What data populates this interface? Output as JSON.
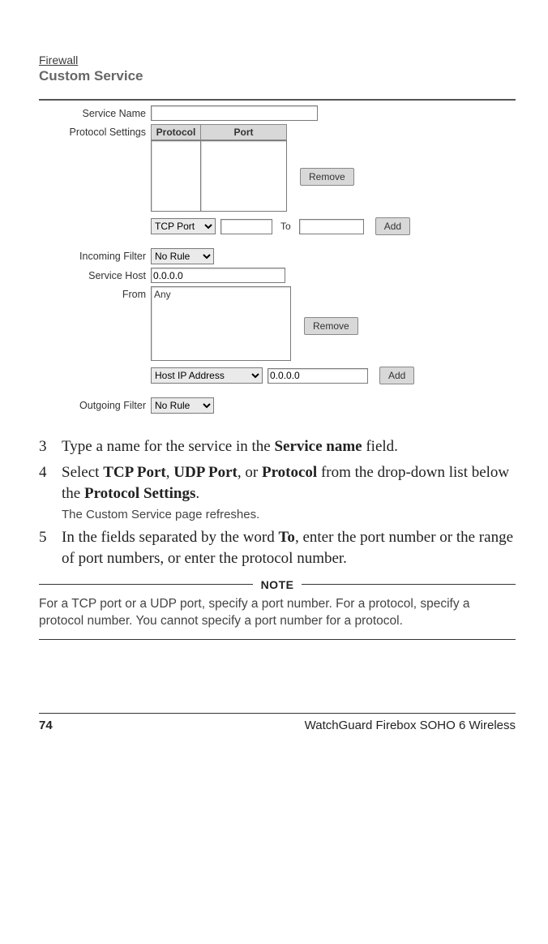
{
  "screenshot": {
    "breadcrumb": "Firewall",
    "title": "Custom Service",
    "labels": {
      "service_name": "Service Name",
      "protocol_settings": "Protocol Settings",
      "incoming_filter": "Incoming Filter",
      "service_host": "Service Host",
      "from": "From",
      "outgoing_filter": "Outgoing Filter",
      "to": "To"
    },
    "headers": {
      "protocol": "Protocol",
      "port": "Port"
    },
    "values": {
      "service_name": "",
      "port_from": "",
      "port_to": "",
      "service_host": "0.0.0.0",
      "from_list_item": "Any",
      "host_value": "0.0.0.0"
    },
    "selects": {
      "proto_type": "TCP Port",
      "incoming_filter": "No Rule",
      "from_type": "Host IP Address",
      "outgoing_filter": "No Rule"
    },
    "buttons": {
      "remove": "Remove",
      "add": "Add"
    }
  },
  "steps": {
    "s3": {
      "num": "3",
      "pre": "Type a name for the service in the ",
      "b1": "Service name",
      "post": " field."
    },
    "s4": {
      "num": "4",
      "t1": "Select ",
      "b1": "TCP Port",
      "t2": ", ",
      "b2": "UDP Port",
      "t3": ", or ",
      "b3": "Protocol",
      "t4": " from the drop-down list below the ",
      "b4": "Protocol Settings",
      "t5": ".",
      "sub": "The Custom Service page refreshes."
    },
    "s5": {
      "num": "5",
      "t1": "In the fields separated by the word ",
      "b1": "To",
      "t2": ", enter the port number or the range of port numbers, or enter the protocol number."
    }
  },
  "note": {
    "label": "NOTE",
    "body": "For a TCP port or a UDP port, specify a port number. For a protocol, specify a protocol number. You cannot specify a port number for a protocol."
  },
  "footer": {
    "page": "74",
    "product": "WatchGuard Firebox SOHO 6 Wireless"
  }
}
